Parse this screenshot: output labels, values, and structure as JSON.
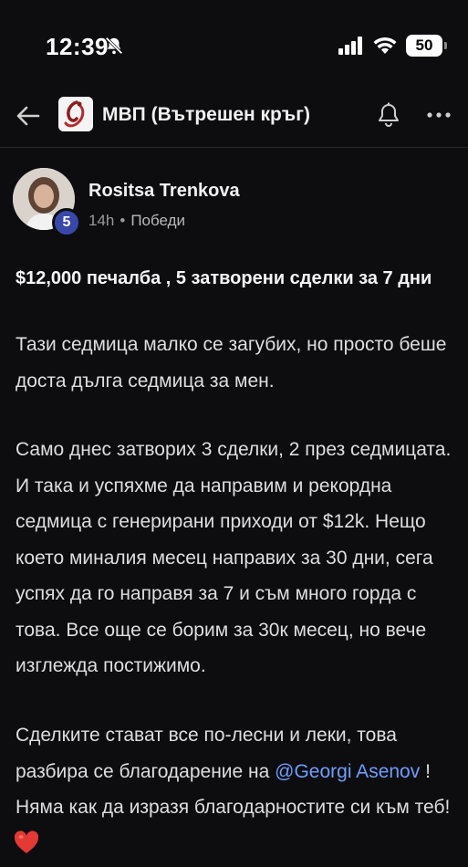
{
  "status_bar": {
    "time": "12:39",
    "battery": "50"
  },
  "header": {
    "group_title": "МВП (Вътрешен кръг)"
  },
  "post": {
    "author": "Rositsa Trenkova",
    "level": "5",
    "time_ago": "14h",
    "separator": "•",
    "category": "Победи",
    "title": "$12,000 печалба , 5 затворени сделки за 7 дни",
    "paragraph1": "Тази седмица малко се загубих, но просто беше доста дълга седмица за мен.",
    "paragraph2": "Само днес затворих 3 сделки, 2 през седмицата. И така и успяхме да направим и рекордна седмица с генерирани приходи от $12k. Нещо което миналия месец направих за 30 дни, сега успях да го направя за 7 и съм много горда с това. Все още се борим за 30к месец, но вече изглежда постижимо.",
    "paragraph3_before": "Сделките стават все по-лесни и леки, това разбира се благодарение на ",
    "mention": "@Georgi Asenov",
    "paragraph3_after": " ! Няма как да изразя благодарностите си към теб!",
    "emoji": "red-heart-icon"
  },
  "colors": {
    "background": "#0d0d0f",
    "mention": "#6f9dff",
    "badge": "#3948a8",
    "heart": "#e53935"
  }
}
